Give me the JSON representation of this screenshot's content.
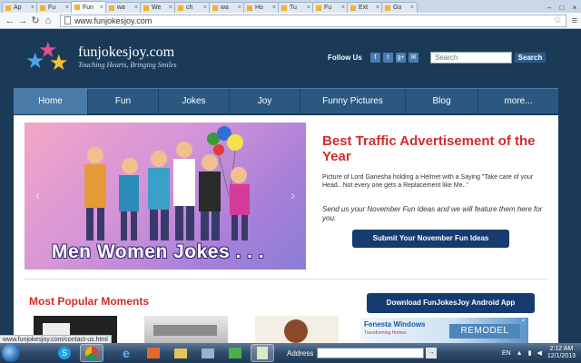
{
  "browser": {
    "tabs": [
      {
        "label": "Ap",
        "active": false
      },
      {
        "label": "Fu",
        "active": false
      },
      {
        "label": "Fun",
        "active": true
      },
      {
        "label": "wa",
        "active": false
      },
      {
        "label": "We",
        "active": false
      },
      {
        "label": "ch",
        "active": false
      },
      {
        "label": "wa",
        "active": false
      },
      {
        "label": "Ho",
        "active": false
      },
      {
        "label": "Tu",
        "active": false
      },
      {
        "label": "Fu",
        "active": false
      },
      {
        "label": "Ext",
        "active": false
      },
      {
        "label": "Go",
        "active": false
      }
    ],
    "url": "www.funjokesjoy.com",
    "status_url": "www.funjokesjoy.com/contact-us.html"
  },
  "site": {
    "logo": "funjokesjoy.com",
    "tagline": "Touching Hearts, Bringing Smiles",
    "follow_label": "Follow Us",
    "social": [
      "f",
      "t",
      "g+",
      "✉"
    ],
    "search_placeholder": "Search",
    "search_button": "Search"
  },
  "nav": [
    {
      "label": "Home",
      "active": true
    },
    {
      "label": "Fun",
      "active": false
    },
    {
      "label": "Jokes",
      "active": false
    },
    {
      "label": "Joy",
      "active": false
    },
    {
      "label": "Funny Pictures",
      "active": false
    },
    {
      "label": "Blog",
      "active": false
    },
    {
      "label": "more...",
      "active": false
    }
  ],
  "slider": {
    "caption": "Men Women Jokes . . ."
  },
  "promo": {
    "title": "Best Traffic Advertisement of the Year",
    "text": "Picture of Lord Ganesha holding a Helmet with a Saying \"Take care of your Head.. Not every one gets a Replacement like Me..\"",
    "text2": "Send us your November Fun Ideas and we will feature them here for you.",
    "button": "Submit Your November Fun Ideas"
  },
  "popular": {
    "title": "Most Popular Moments",
    "android_button": "Download FunJokesJoy Android App"
  },
  "ad": {
    "brand": "Fenesta",
    "brand_suffix": "Windows",
    "sub": "Transforming Homes",
    "cta": "REMODEL"
  },
  "taskbar": {
    "address_label": "Address",
    "lang": "EN",
    "time": "2:12 AM",
    "date": "12/1/2013"
  },
  "colors": {
    "page_bg": "#1a3a58",
    "nav_bg": "#2c5880",
    "accent_red": "#d32c2c",
    "button_blue": "#153b70"
  }
}
